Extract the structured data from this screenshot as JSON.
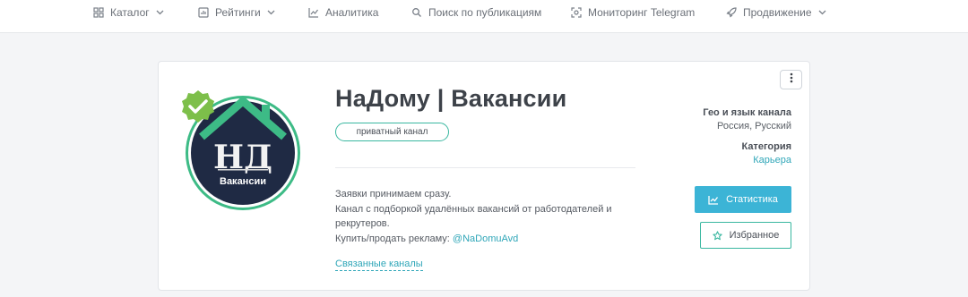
{
  "nav": {
    "items": [
      {
        "label": "Каталог",
        "icon": "grid-icon",
        "dropdown": true
      },
      {
        "label": "Рейтинги",
        "icon": "ranking-icon",
        "dropdown": true
      },
      {
        "label": "Аналитика",
        "icon": "chart-line-icon",
        "dropdown": false
      },
      {
        "label": "Поиск по публикациям",
        "icon": "search-icon",
        "dropdown": false
      },
      {
        "label": "Мониторинг Telegram",
        "icon": "scan-icon",
        "dropdown": false
      },
      {
        "label": "Продвижение",
        "icon": "rocket-icon",
        "dropdown": true
      }
    ]
  },
  "channel": {
    "title": "НаДому | Вакансии",
    "privacy_badge": "приватный канал",
    "avatar": {
      "letters": "НД",
      "caption": "Вакансии",
      "verified": true
    },
    "description": {
      "line1": "Заявки принимаем сразу.",
      "line2": "Канал с подборкой удалённых вакансий от работодателей и рекрутеров.",
      "ad_prefix": "Купить/продать рекламу:",
      "ad_handle": "@NaDomuAvd"
    },
    "related_link": "Связанные каналы"
  },
  "meta": {
    "geo_label": "Гео и язык канала",
    "geo_value": "Россия, Русский",
    "category_label": "Категория",
    "category_value": "Карьера"
  },
  "actions": {
    "stats_label": "Статистика",
    "favorite_label": "Избранное"
  },
  "colors": {
    "accent_teal": "#39b7a0",
    "button_blue": "#3cb4d6",
    "link": "#2fa6b8",
    "avatar_bg": "#1f2a44",
    "avatar_ring": "#3dbb86",
    "verified_badge": "#7dbf4a"
  }
}
